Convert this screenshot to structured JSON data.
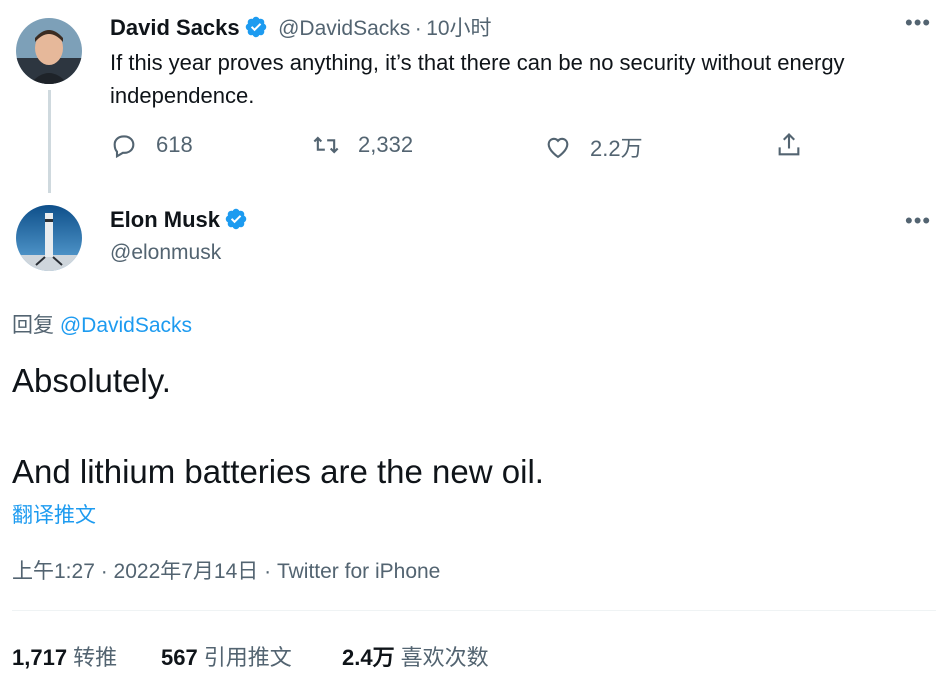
{
  "parent_tweet": {
    "author_name": "David Sacks",
    "handle": "@DavidSacks",
    "separator": "·",
    "time": "10小时",
    "text": "If this year proves anything, it’s that there can be no security without energy independence.",
    "actions": {
      "replies": "618",
      "retweets": "2,332",
      "likes": "2.2万"
    },
    "more_label": "•••"
  },
  "main_tweet": {
    "author_name": "Elon Musk",
    "handle": "@elonmusk",
    "more_label": "•••",
    "reply_prefix": "回复",
    "reply_to": "@DavidSacks",
    "text_line1": "Absolutely.",
    "text_line2": "And lithium batteries are the new oil.",
    "translate_link": "翻译推文",
    "timestamp": "上午1:27 · 2022年7月14日 · Twitter for iPhone",
    "stats": {
      "retweets_count": "1,717",
      "retweets_label": "转推",
      "quotes_count": "567",
      "quotes_label": "引用推文",
      "likes_count": "2.4万",
      "likes_label": "喜欢次数"
    }
  },
  "colors": {
    "verified": "#1d9bf0",
    "link": "#1d9bf0",
    "secondary_text": "#536471",
    "primary_text": "#0f1419"
  },
  "icons": [
    "verified-badge-icon",
    "reply-icon",
    "retweet-icon",
    "like-icon",
    "share-icon",
    "more-icon"
  ]
}
